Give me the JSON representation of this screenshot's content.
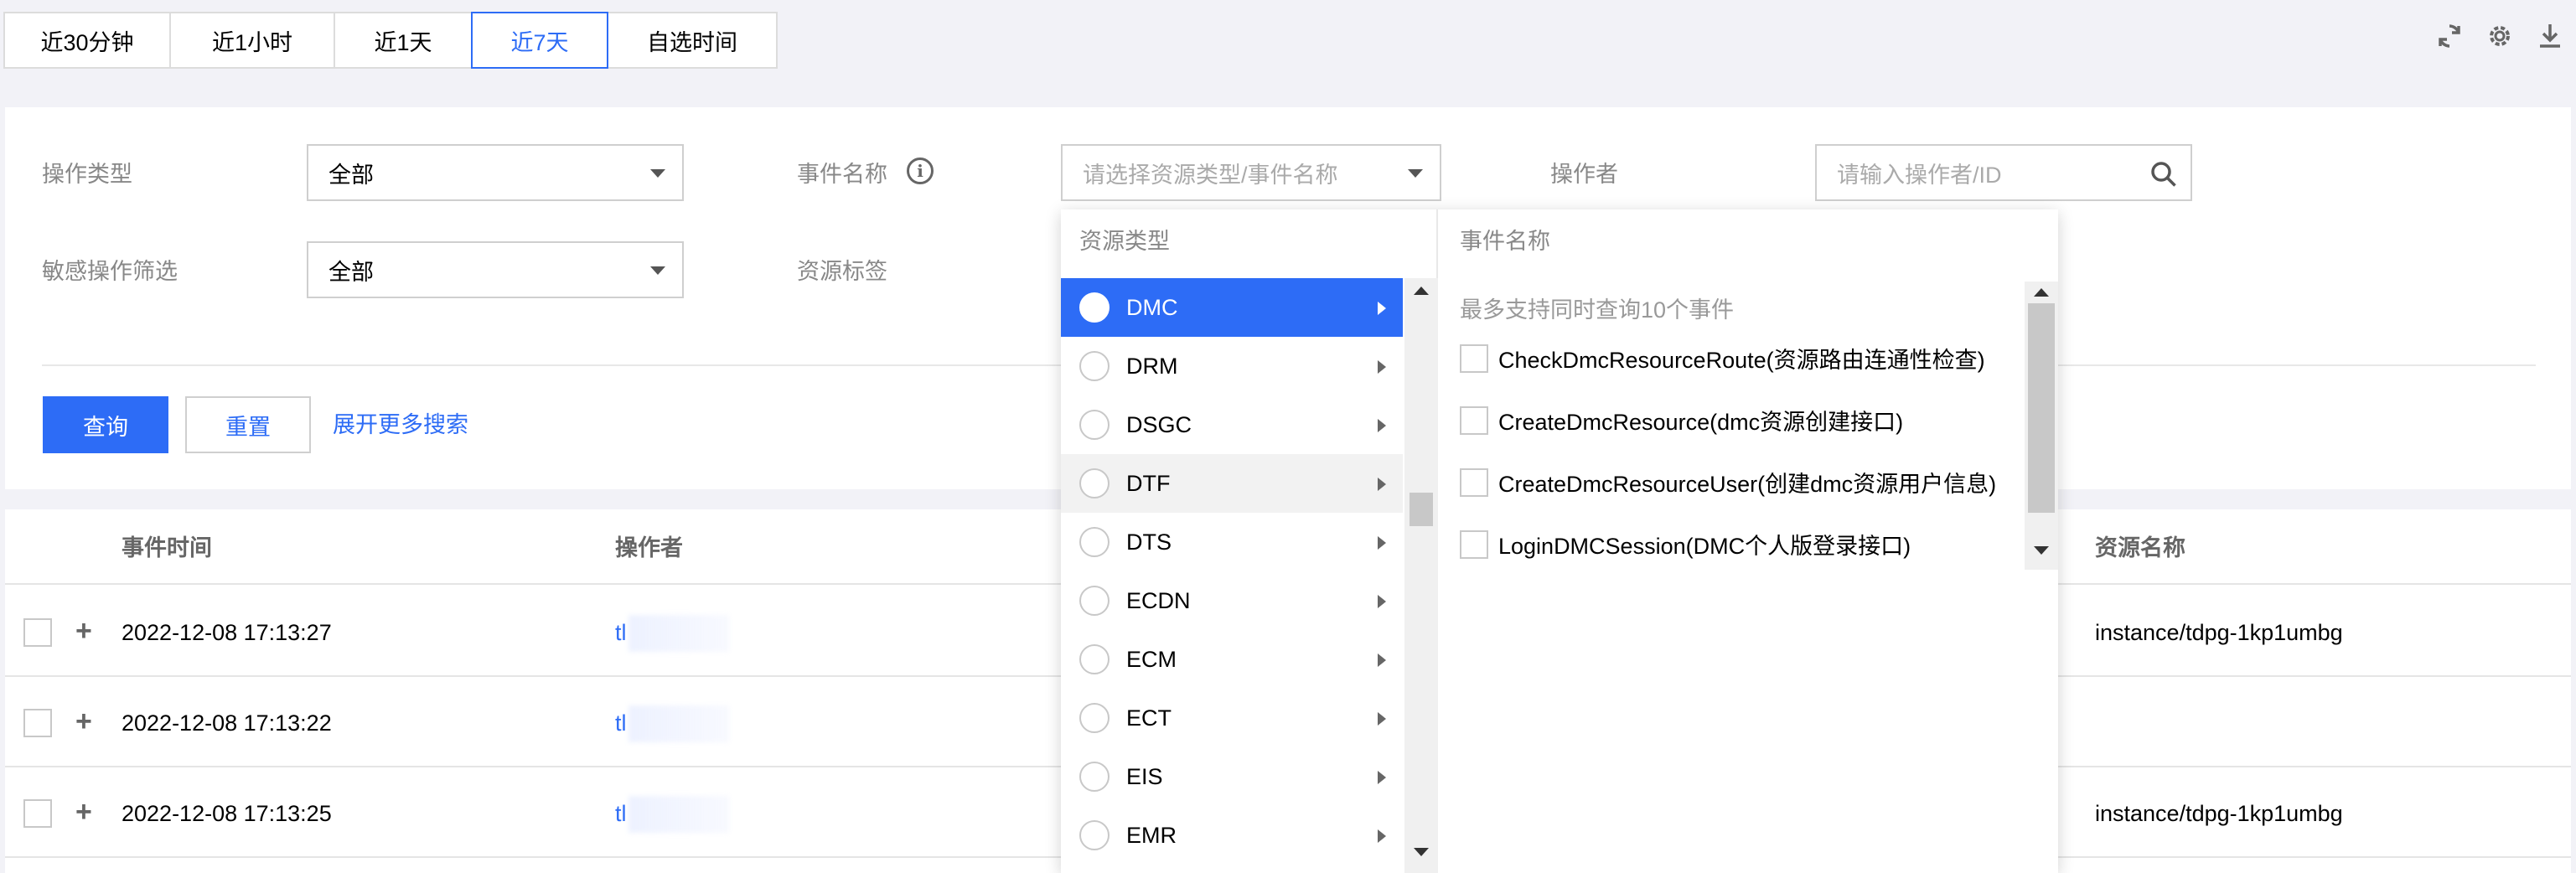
{
  "time_range": {
    "tabs": [
      {
        "label": "近30分钟",
        "active": false
      },
      {
        "label": "近1小时",
        "active": false
      },
      {
        "label": "近1天",
        "active": false
      },
      {
        "label": "近7天",
        "active": true
      },
      {
        "label": "自选时间",
        "active": false
      }
    ]
  },
  "toolbar_icons": [
    "refresh-icon",
    "gear-icon",
    "download-icon"
  ],
  "filters": {
    "op_type_label": "操作类型",
    "op_type_value": "全部",
    "event_name_label": "事件名称",
    "event_name_placeholder": "请选择资源类型/事件名称",
    "operator_label": "操作者",
    "operator_placeholder": "请输入操作者/ID",
    "sensitive_label": "敏感操作筛选",
    "sensitive_value": "全部",
    "resource_tag_label": "资源标签",
    "query_button": "查询",
    "reset_button": "重置",
    "more_link": "展开更多搜索"
  },
  "table": {
    "headers": {
      "event_time": "事件时间",
      "operator": "操作者",
      "resource_name": "资源名称"
    },
    "rows": [
      {
        "time": "2022-12-08 17:13:27",
        "operator_prefix": "tl",
        "resource": "instance/tdpg-1kp1umbg"
      },
      {
        "time": "2022-12-08 17:13:22",
        "operator_prefix": "tl",
        "resource": ""
      },
      {
        "time": "2022-12-08 17:13:25",
        "operator_prefix": "tl",
        "resource": "instance/tdpg-1kp1umbg"
      }
    ]
  },
  "cascader": {
    "resource_header": "资源类型",
    "event_header": "事件名称",
    "resources": [
      {
        "label": "DMC",
        "state": "selected"
      },
      {
        "label": "DRM",
        "state": ""
      },
      {
        "label": "DSGC",
        "state": ""
      },
      {
        "label": "DTF",
        "state": "hover"
      },
      {
        "label": "DTS",
        "state": ""
      },
      {
        "label": "ECDN",
        "state": ""
      },
      {
        "label": "ECM",
        "state": ""
      },
      {
        "label": "ECT",
        "state": ""
      },
      {
        "label": "EIS",
        "state": ""
      },
      {
        "label": "EMR",
        "state": ""
      }
    ],
    "hint": "最多支持同时查询10个事件",
    "events": [
      "CheckDmcResourceRoute(资源路由连通性检查)",
      "CreateDmcResource(dmc资源创建接口)",
      "CreateDmcResourceUser(创建dmc资源用户信息)",
      "LoginDMCSession(DMC个人版登录接口)"
    ]
  },
  "colors": {
    "accent": "#2d6cf6",
    "background": "#f2f2f7"
  }
}
